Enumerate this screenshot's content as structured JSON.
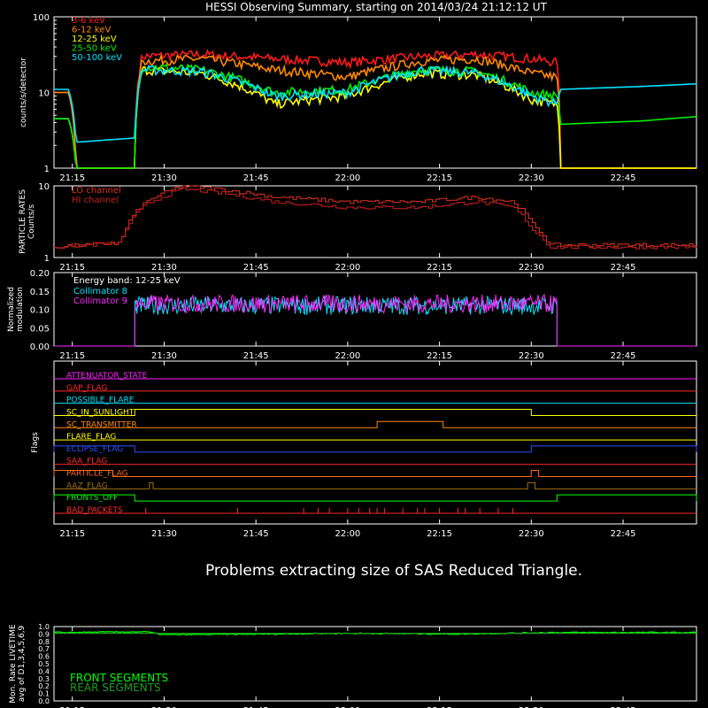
{
  "title": "HESSI Observing Summary, starting on 2014/03/24 21:12:12 UT",
  "time_ticks": [
    "21:15",
    "21:30",
    "21:45",
    "22:00",
    "22:15",
    "22:30",
    "22:45"
  ],
  "message": "Problems extracting size of SAS Reduced Triangle.",
  "colors": {
    "background": "#000000",
    "axes": "#ffffff",
    "band_3_6": "#ff1a1a",
    "band_6_12": "#ff8a00",
    "band_12_25": "#ffff00",
    "band_25_50": "#00ee00",
    "band_50_100": "#00e5ff",
    "lo_channel": "#e0301a",
    "hi_channel": "#c81e1e",
    "coll8": "#00e5ff",
    "coll9": "#ff2aff",
    "front": "#00ff00",
    "rear": "#1f9b1f"
  },
  "chart_data": [
    {
      "id": "countrate",
      "type": "line",
      "ylabel": "counts/s/detector",
      "yscale": "log",
      "ylim": [
        1,
        100
      ],
      "yticks": [
        "1",
        "10",
        "100"
      ],
      "x": [
        21.2,
        21.24,
        21.26,
        21.42,
        21.44,
        21.6,
        21.8,
        22.0,
        22.2,
        22.35,
        22.5,
        22.57,
        22.58,
        22.8,
        22.95
      ],
      "series": [
        {
          "name": "3-6 keV",
          "color_key": "band_3_6",
          "values": [
            10,
            10,
            1,
            1,
            30,
            32,
            28,
            25,
            30,
            32,
            28,
            25,
            1,
            1,
            1
          ]
        },
        {
          "name": "6-12 keV",
          "color_key": "band_6_12",
          "values": [
            10,
            10,
            1,
            1,
            26,
            28,
            20,
            16,
            26,
            28,
            18,
            16,
            1,
            1,
            1
          ]
        },
        {
          "name": "12-25 keV",
          "color_key": "band_12_25",
          "values": [
            4.5,
            4.5,
            1,
            1,
            20,
            18,
            7,
            9,
            18,
            17,
            8,
            7,
            1,
            1,
            1
          ]
        },
        {
          "name": "25-50 keV",
          "color_key": "band_25_50",
          "values": [
            4.5,
            4.5,
            1,
            1,
            22,
            20,
            10,
            11,
            20,
            19,
            10,
            9,
            3.8,
            4.2,
            4.8
          ]
        },
        {
          "name": "50-100 keV",
          "color_key": "band_50_100",
          "values": [
            11,
            11,
            2.2,
            2.5,
            20,
            19,
            9,
            10,
            20,
            18,
            9,
            7,
            11,
            12,
            13
          ]
        }
      ]
    },
    {
      "id": "particle",
      "type": "line",
      "ylabel": "PARTICLE RATES\nCounts/s",
      "yscale": "log",
      "ylim": [
        1,
        10
      ],
      "yticks": [
        "1",
        "10"
      ],
      "x": [
        21.2,
        21.38,
        21.4,
        21.45,
        21.55,
        21.65,
        21.8,
        22.0,
        22.2,
        22.35,
        22.45,
        22.5,
        22.55,
        22.95
      ],
      "series": [
        {
          "name": "LO channel",
          "color_key": "lo_channel",
          "values": [
            1.4,
            1.6,
            3,
            6,
            10,
            9,
            7,
            6,
            6,
            7,
            6,
            3,
            1.5,
            1.5
          ]
        },
        {
          "name": "HI channel",
          "color_key": "hi_channel",
          "values": [
            1.4,
            1.6,
            2.8,
            5.5,
            9,
            8,
            6,
            5,
            5,
            6,
            5,
            2.5,
            1.4,
            1.4
          ]
        }
      ]
    },
    {
      "id": "modulation",
      "type": "line",
      "ylabel": "Normalized\nmodulation",
      "ylim": [
        0,
        0.2
      ],
      "yticks": [
        "0.00",
        "0.05",
        "0.10",
        "0.15",
        "0.20"
      ],
      "annotation": "Energy band: 12-25 keV",
      "active_range": [
        21.42,
        22.57
      ],
      "series": [
        {
          "name": "Collimator 8",
          "color_key": "coll8",
          "mean": 0.11
        },
        {
          "name": "Collimator 9",
          "color_key": "coll9",
          "mean": 0.115
        }
      ]
    },
    {
      "id": "flags",
      "type": "line",
      "ylabel": "Flags",
      "flags": [
        {
          "name": "ATTENUATOR_STATE",
          "color": "#ff22ff",
          "segments": []
        },
        {
          "name": "GAP_FLAG",
          "color": "#ff2a2a",
          "segments": []
        },
        {
          "name": "POSSIBLE_FLARE",
          "color": "#00e5ff",
          "segments": []
        },
        {
          "name": "SC_IN_SUNLIGHT",
          "color": "#ffff00",
          "segments": [
            [
              21.42,
              22.5
            ]
          ]
        },
        {
          "name": "SC_TRANSMITTER",
          "color": "#ff8a00",
          "segments": [
            [
              22.08,
              22.26
            ]
          ]
        },
        {
          "name": "FLARE_FLAG",
          "color": "#ffff00",
          "segments": []
        },
        {
          "name": "ECLIPSE_FLAG",
          "color": "#2a50ff",
          "segments": [
            [
              21.2,
              21.42
            ],
            [
              22.5,
              22.95
            ]
          ]
        },
        {
          "name": "SAA_FLAG",
          "color": "#ff2a2a",
          "segments": []
        },
        {
          "name": "PARTICLE_FLAG",
          "color": "#ff6a1a",
          "segments": [
            [
              21.2,
              21.36
            ],
            [
              22.5,
              22.52
            ]
          ]
        },
        {
          "name": "AAZ_FLAG",
          "color": "#a06f10",
          "segments": [
            [
              21.46,
              21.47
            ],
            [
              22.49,
              22.51
            ]
          ]
        },
        {
          "name": "FRONTS_OFF",
          "color": "#00ff00",
          "segments": [
            [
              21.2,
              21.42
            ],
            [
              22.57,
              22.95
            ]
          ]
        },
        {
          "name": "BAD_PACKETS",
          "color": "#ff2a2a",
          "spikes": [
            21.45,
            21.7,
            21.88,
            21.92,
            21.95,
            22.0,
            22.03,
            22.06,
            22.08,
            22.1,
            22.15,
            22.19,
            22.21,
            22.25,
            22.3,
            22.32,
            22.36,
            22.41,
            22.45
          ]
        }
      ]
    },
    {
      "id": "livetime",
      "type": "line",
      "ylabel": "Mon. Rate LIVETIME\navg of D1,3,4,5,6,9",
      "ylim": [
        0,
        1
      ],
      "yticks": [
        "0.0",
        "0.1",
        "0.2",
        "0.3",
        "0.4",
        "0.5",
        "0.6",
        "0.7",
        "0.8",
        "0.9",
        "1.0"
      ],
      "series": [
        {
          "name": "FRONT SEGMENTS",
          "color_key": "front",
          "x": [
            21.2,
            21.45,
            21.5,
            21.8,
            22.0,
            22.3,
            22.55,
            22.95
          ],
          "values": [
            0.92,
            0.93,
            0.89,
            0.9,
            0.91,
            0.9,
            0.92,
            0.92
          ]
        },
        {
          "name": "REAR SEGMENTS",
          "color_key": "rear",
          "x": [
            21.2,
            22.95
          ],
          "values": [
            0.91,
            0.91
          ]
        }
      ]
    }
  ]
}
